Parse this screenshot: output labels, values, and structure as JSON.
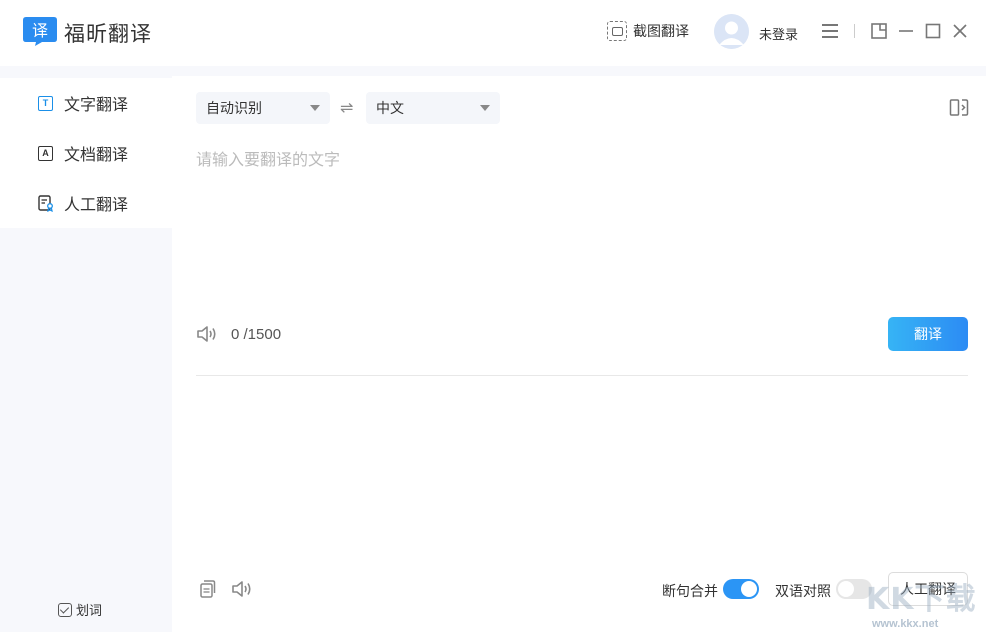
{
  "app": {
    "logo_char": "译",
    "name": "福昕翻译"
  },
  "header": {
    "screenshot_translate": "截图翻译",
    "login_status": "未登录"
  },
  "sidebar": {
    "items": [
      {
        "label": "文字翻译",
        "icon": "text-translate-icon",
        "glyph": "T",
        "active": true
      },
      {
        "label": "文档翻译",
        "icon": "document-translate-icon",
        "glyph": "A",
        "active": false
      },
      {
        "label": "人工翻译",
        "icon": "human-translate-icon",
        "glyph": "",
        "active": false
      }
    ],
    "word_pick": "划词"
  },
  "translator": {
    "source_lang": "自动识别",
    "target_lang": "中文",
    "swap_glyph": "⇌",
    "input_placeholder": "请输入要翻译的文字",
    "input_value": "",
    "char_count": "0 /1500",
    "translate_button": "翻译"
  },
  "output": {
    "sentence_merge_label": "断句合并",
    "sentence_merge_on": true,
    "bilingual_label": "双语对照",
    "bilingual_on": false,
    "human_translate_button": "人工翻译"
  },
  "watermark": {
    "logo_text": "KK下载",
    "url": "www.kkx.net"
  },
  "colors": {
    "accent": "#2b95f5",
    "sidebar_bg": "#f7f8fc",
    "select_bg": "#f4f6fa"
  }
}
